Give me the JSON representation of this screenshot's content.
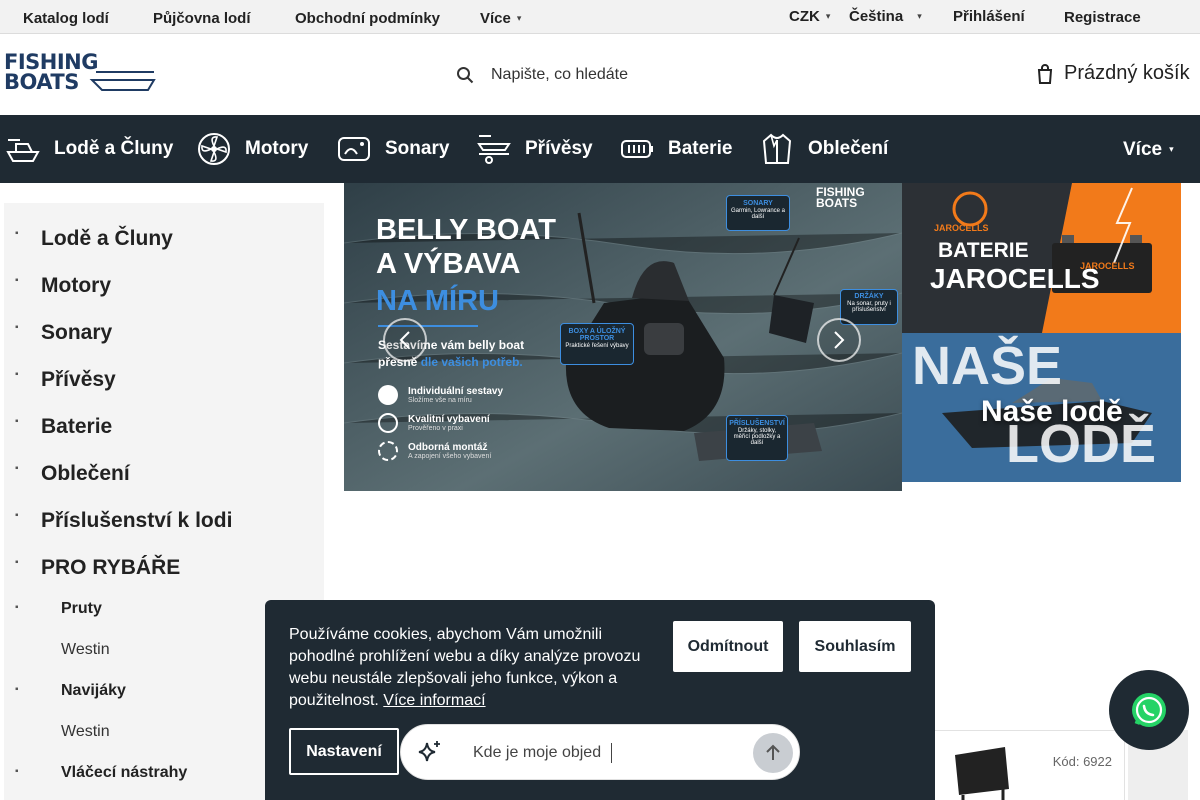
{
  "topbar": {
    "links": [
      "Katalog lodí",
      "Půjčovna lodí",
      "Obchodní podmínky"
    ],
    "more_label": "Více",
    "currency": "CZK",
    "language": "Čeština",
    "login": "Přihlášení",
    "register": "Registrace"
  },
  "header": {
    "logo": "FISHING BOATS",
    "search_placeholder": "Napište, co hledáte",
    "cart_label": "Prázdný košík"
  },
  "nav": {
    "items": [
      "Lodě a Čluny",
      "Motory",
      "Sonary",
      "Přívěsy",
      "Baterie",
      "Oblečení"
    ],
    "more_label": "Více"
  },
  "sidebar": {
    "categories": [
      "Lodě a Čluny",
      "Motory",
      "Sonary",
      "Přívěsy",
      "Baterie",
      "Oblečení",
      "Příslušenství k lodi",
      "PRO RYBÁŘE"
    ],
    "subs": [
      {
        "label": "Pruty",
        "bold": true
      },
      {
        "label": "Westin",
        "bold": false
      },
      {
        "label": "Navijáky",
        "bold": true
      },
      {
        "label": "Westin",
        "bold": false
      },
      {
        "label": "Vláčecí nástrahy",
        "bold": true
      }
    ]
  },
  "banner_main": {
    "title_line1": "BELLY BOAT",
    "title_line2": "A VÝBAVA",
    "title_line3": "NA MÍRU",
    "subtitle_a": "Sestavíme vám belly boat",
    "subtitle_b": "přesně",
    "subtitle_c": "dle vašich potřeb.",
    "features": [
      {
        "title": "Individuální sestavy",
        "desc": "Složíme vše na míru"
      },
      {
        "title": "Kvalitní vybavení",
        "desc": "Prověřeno v praxi"
      },
      {
        "title": "Odborná montáž",
        "desc": "A zapojení všeho vybavení"
      }
    ],
    "logo": "FISHING BOATS",
    "callouts": [
      {
        "title": "SONARY",
        "desc": "Garmin, Lowrance a další"
      },
      {
        "title": "DRŽÁKY",
        "desc": "Na sonar, pruty i příslušenství"
      },
      {
        "title": "BOXY A ÚLOŽNÝ PROSTOR",
        "desc": "Praktické řešení výbavy"
      },
      {
        "title": "PŘÍSLUŠENSTVÍ",
        "desc": "Držáky, stolky, měřicí podložky a další"
      }
    ]
  },
  "banner_battery": {
    "brand": "JAROCELLS",
    "line1": "BATERIE",
    "line2": "JAROCELLS",
    "box_label": "JAROCELLS"
  },
  "banner_boats": {
    "bg_word1": "NAŠE",
    "bg_word2": "LODĚ",
    "label": "Naše lodě"
  },
  "product": {
    "code": "Kód: 6922"
  },
  "cookie": {
    "text": "Používáme cookies, abychom Vám umožnili pohodlné prohlížení webu a díky analýze provozu webu neustále zlepšovali jeho funkce, výkon a použitelnost.",
    "more": "Více informací",
    "reject": "Odmítnout",
    "accept": "Souhlasím",
    "settings": "Nastavení"
  },
  "chat": {
    "placeholder": "Kde je moje objed"
  },
  "icons": {
    "search": "search-icon",
    "cart": "cart-icon",
    "whatsapp": "whatsapp-icon",
    "sparkle": "sparkle-icon",
    "send": "send-arrow-icon"
  },
  "colors": {
    "nav_bg": "#1f2a33",
    "accent_blue": "#3d8ee0",
    "whatsapp_green": "#25d366",
    "battery_orange": "#f27a1a"
  }
}
